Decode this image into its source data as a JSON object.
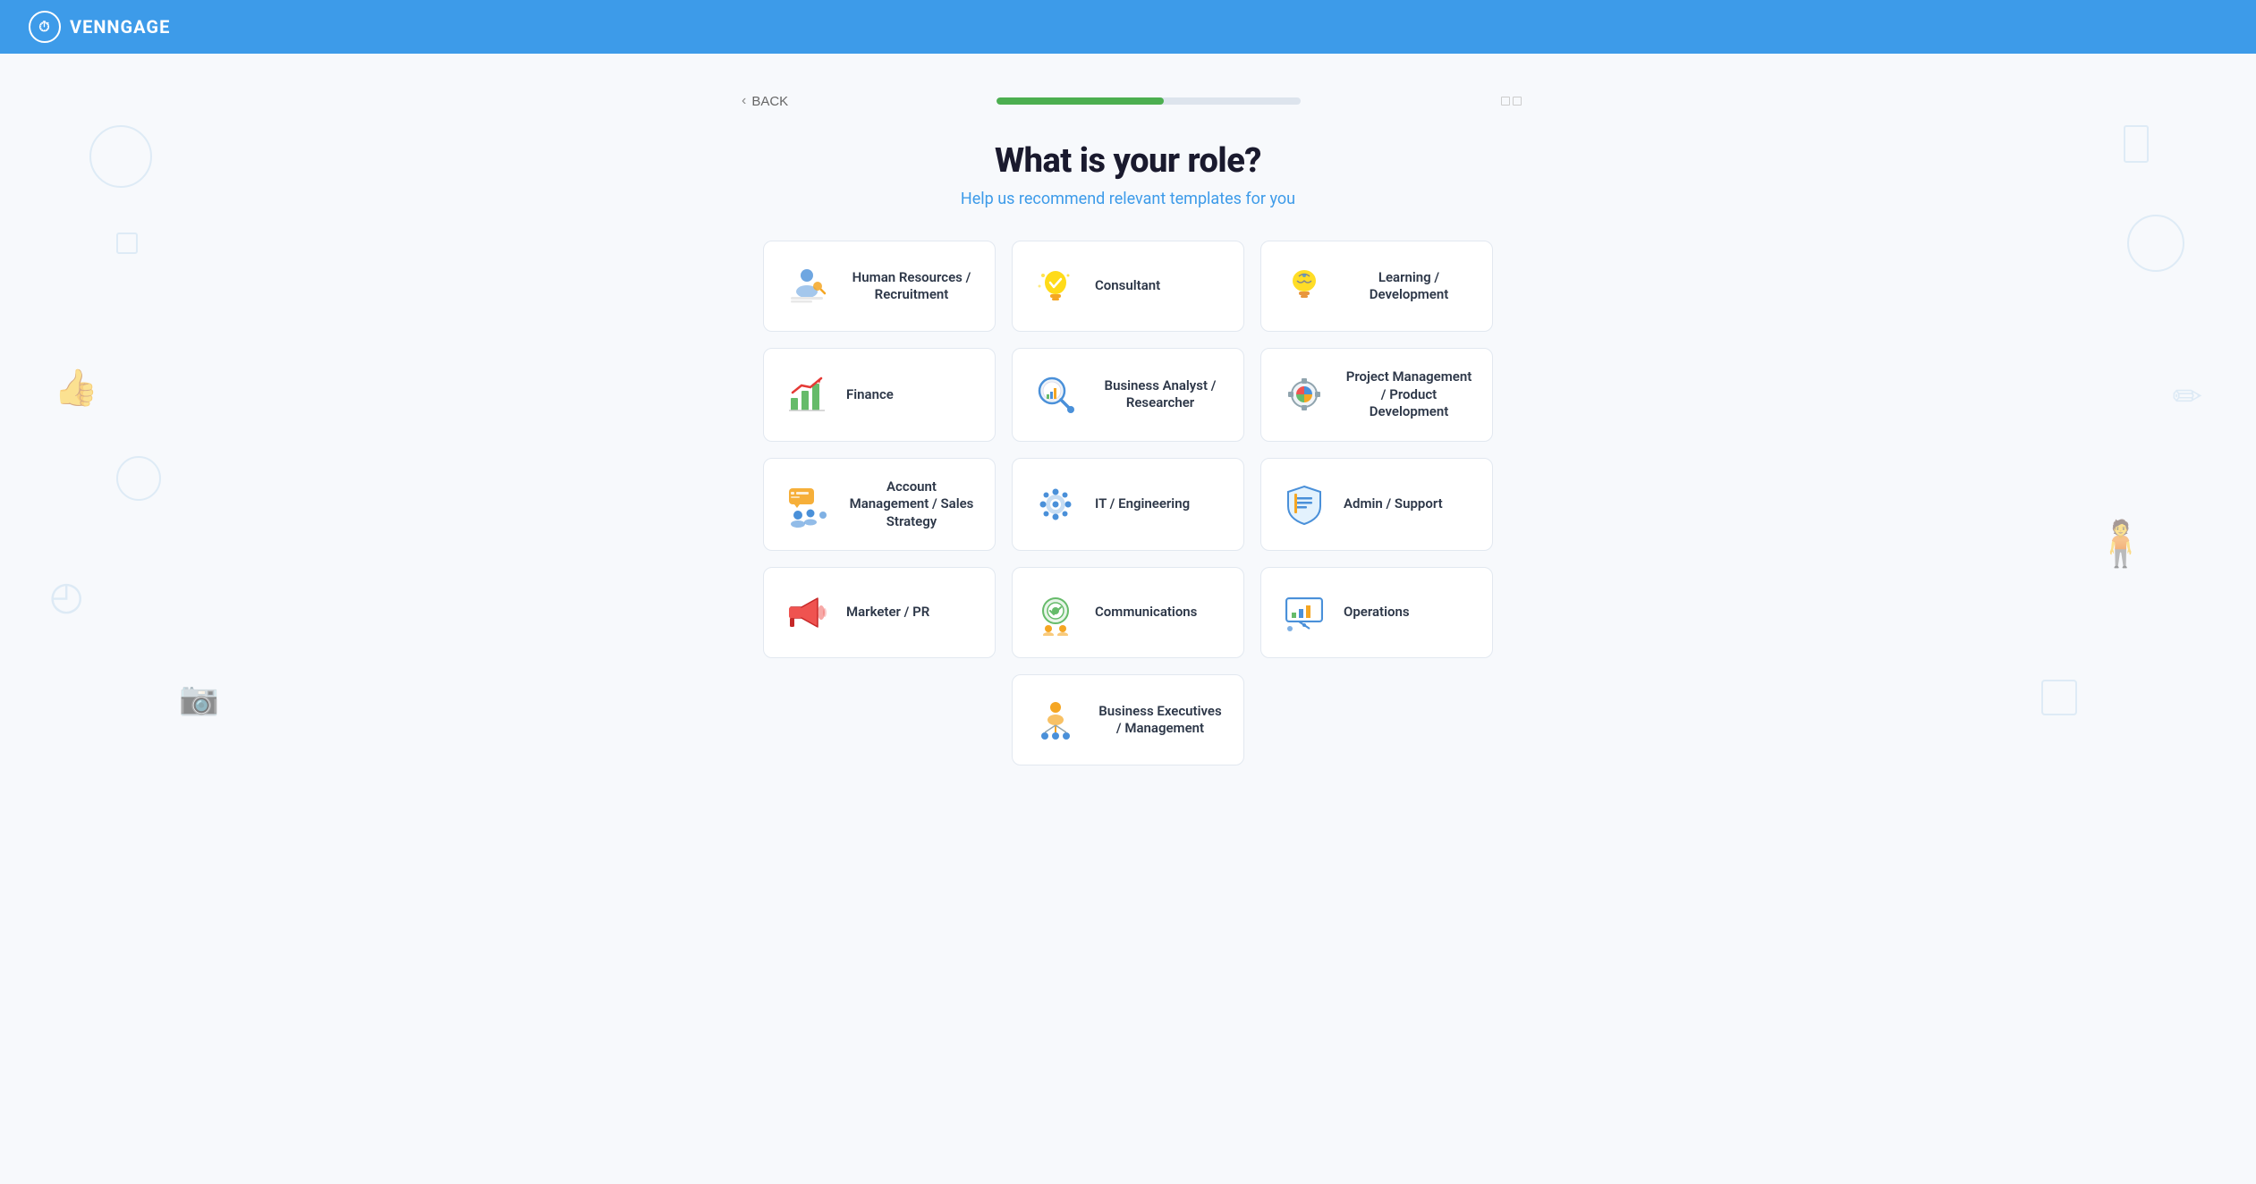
{
  "header": {
    "logo_text": "VENNGAGE",
    "logo_icon": "⏱"
  },
  "nav": {
    "back_label": "BACK",
    "progress_percent": 55
  },
  "page": {
    "title": "What is your role?",
    "subtitle": "Help us recommend relevant templates for you"
  },
  "roles": [
    {
      "id": "human-resources",
      "label": "Human Resources / Recruitment",
      "icon_name": "hr-icon"
    },
    {
      "id": "consultant",
      "label": "Consultant",
      "icon_name": "consultant-icon"
    },
    {
      "id": "learning-development",
      "label": "Learning / Development",
      "icon_name": "learning-icon"
    },
    {
      "id": "finance",
      "label": "Finance",
      "icon_name": "finance-icon"
    },
    {
      "id": "business-analyst",
      "label": "Business Analyst / Researcher",
      "icon_name": "analyst-icon"
    },
    {
      "id": "project-management",
      "label": "Project Management / Product Development",
      "icon_name": "project-icon"
    },
    {
      "id": "account-management",
      "label": "Account Management / Sales Strategy",
      "icon_name": "sales-icon"
    },
    {
      "id": "it-engineering",
      "label": "IT / Engineering",
      "icon_name": "it-icon"
    },
    {
      "id": "admin-support",
      "label": "Admin / Support",
      "icon_name": "admin-icon"
    },
    {
      "id": "marketer-pr",
      "label": "Marketer / PR",
      "icon_name": "marketer-icon"
    },
    {
      "id": "communications",
      "label": "Communications",
      "icon_name": "comms-icon"
    },
    {
      "id": "operations",
      "label": "Operations",
      "icon_name": "operations-icon"
    },
    {
      "id": "business-executives",
      "label": "Business Executives / Management",
      "icon_name": "executives-icon"
    }
  ]
}
